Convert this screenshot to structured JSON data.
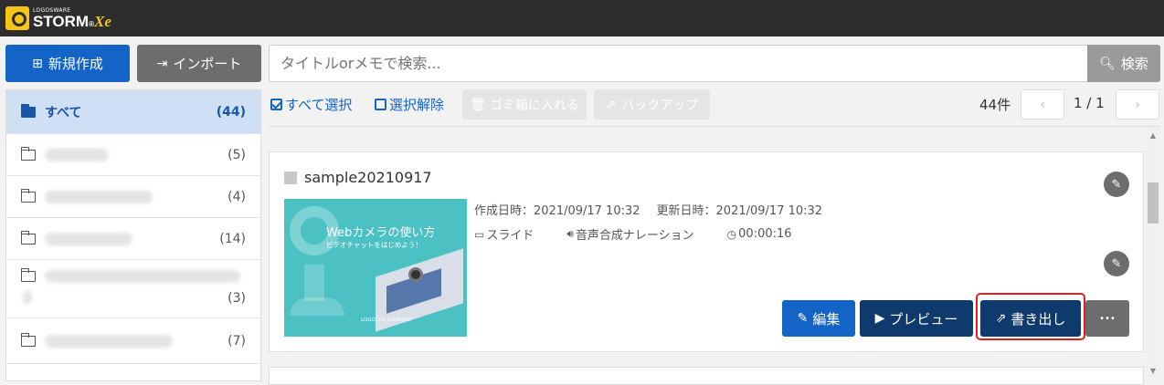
{
  "header": {
    "logo_small": "LOGOSWARE",
    "logo_main": "STORM",
    "logo_reg": "®",
    "logo_suffix": "Xe"
  },
  "toolbar": {
    "new_label": "新規作成",
    "import_label": "インポート",
    "search_placeholder": "タイトルorメモで検索...",
    "search_button": "検索"
  },
  "sidebar": {
    "folders": [
      {
        "name": "すべて",
        "count": "(44)",
        "active": true
      },
      {
        "name": "",
        "count": "(5)"
      },
      {
        "name": "",
        "count": "(4)"
      },
      {
        "name": "",
        "count": "(14)"
      },
      {
        "name": "",
        "count": "(3)"
      },
      {
        "name": "",
        "count": "(7)"
      }
    ]
  },
  "list_toolbar": {
    "select_all": "すべて選択",
    "deselect": "選択解除",
    "trash": "ゴミ箱に入れる",
    "backup": "バックアップ",
    "total": "44件",
    "page": "1 / 1",
    "prev": "‹",
    "next": "›"
  },
  "card": {
    "title": "sample20210917",
    "created": "作成日時：2021/09/17 10:32",
    "updated": "更新日時：2021/09/17 10:32",
    "type": "スライド",
    "narration": "音声合成ナレーション",
    "duration": "00:00:16",
    "thumb_title": "Webカメラの使い方",
    "thumb_sub": "ビデオチャットをはじめよう！",
    "thumb_company": "LOGOCOS COMPANY",
    "actions": {
      "edit": "編集",
      "preview": "プレビュー",
      "export": "書き出し",
      "more": "•••"
    }
  },
  "colors": {
    "primary": "#1464c8",
    "dark_navy": "#0f3a6e",
    "gray_button": "#6d6d6d",
    "highlight_red": "#e02020",
    "thumb_teal": "#4bc1c4"
  }
}
